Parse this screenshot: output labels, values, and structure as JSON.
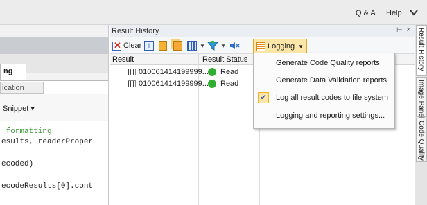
{
  "header": {
    "qa_label": "Q & A",
    "help_label": "Help",
    "collapse_icon": "chevron-down-icon"
  },
  "editor": {
    "tab_active": "ng",
    "tab_inactive": "ication",
    "snippet_label": "Snippet ▾",
    "code_lines": [
      " formatting",
      "esults, readerProper",
      "ecoded)",
      "ecodeResults[0].cont"
    ]
  },
  "result_history": {
    "title": "Result History",
    "pin_icon": "pin-icon",
    "close_icon": "close-icon",
    "toolbar": {
      "clear_label": "Clear",
      "logging_label": "Logging"
    },
    "columns": [
      "Result",
      "Result Status"
    ],
    "rows": [
      {
        "result": "010061414199999...",
        "status": "Read"
      },
      {
        "result": "010061414199999...",
        "status": "Read"
      }
    ]
  },
  "logging_menu": {
    "items": [
      {
        "label": "Generate Code Quality reports",
        "checked": false
      },
      {
        "label": "Generate Data Validation reports",
        "checked": false
      },
      {
        "label": "Log all result codes to file system",
        "checked": true
      },
      {
        "label": "Logging and reporting settings...",
        "checked": false
      }
    ]
  },
  "side_tabs": [
    "Result History",
    "Image Panel",
    "Code Quality"
  ],
  "colors": {
    "status_read": "#2fae2f",
    "code_comment": "#3c9a3c",
    "logging_highlight": "#fde7a8"
  }
}
